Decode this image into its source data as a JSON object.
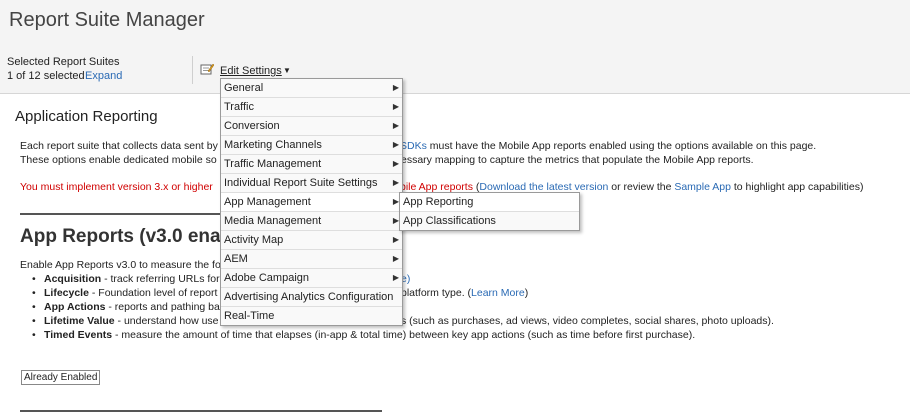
{
  "page_title": "Report Suite Manager",
  "toolbar": {
    "selected_label": "Selected Report Suites",
    "selected_count": "1 of 12 selected",
    "expand_label": "Expand",
    "edit_settings_label": "Edit Settings",
    "edit_icon": "edit-note-icon",
    "caret_icon": "caret-down-icon"
  },
  "section": {
    "heading": "Application Reporting",
    "desc1_prefix": "Each report suite that collects data sent by",
    "desc1_link": "SDKs",
    "desc1_suffix": "must have the Mobile App reports enabled using the options available on this page.",
    "desc2_prefix": "These options enable dedicated mobile so",
    "desc2_suffix": "essary mapping to capture the metrics that populate the Mobile App reports.",
    "warning_prefix": "You must implement version 3.x or higher",
    "warning_mid": "bile App reports",
    "warning_paren_open": " (",
    "warning_link1": "Download the latest version",
    "warning_or": " or review the ",
    "warning_link2": "Sample App",
    "warning_suffix": " to highlight app capabilities)"
  },
  "app_reports": {
    "title": "App Reports (v3.0 enab",
    "intro": "Enable App Reports v3.0 to measure the fo",
    "bullets": [
      {
        "term": "Acquisition",
        "text": " - track referring URLs for",
        "tail_link": "e)"
      },
      {
        "term": "Lifecycle",
        "text": " - Foundation level of report",
        "tail": "platform type. (",
        "tail_link": "Learn More",
        "tail_end": ")"
      },
      {
        "term": "App Actions",
        "text": " - reports and pathing ba"
      },
      {
        "term": "Lifetime Value",
        "text": " - understand how use",
        "tail": "s (such as purchases, ad views, video completes, social shares, photo uploads)."
      },
      {
        "term": "Timed Events",
        "text": " - measure the amount of time that elapses (in-app & total time) between key app actions (such as time before first purchase)."
      }
    ],
    "enabled_button": "Already Enabled"
  },
  "menu": {
    "items": [
      {
        "label": "General",
        "has_submenu": true
      },
      {
        "label": "Traffic",
        "has_submenu": true
      },
      {
        "label": "Conversion",
        "has_submenu": true
      },
      {
        "label": "Marketing Channels",
        "has_submenu": true
      },
      {
        "label": "Traffic Management",
        "has_submenu": true
      },
      {
        "label": "Individual Report Suite Settings",
        "has_submenu": true
      },
      {
        "label": "App Management",
        "has_submenu": true
      },
      {
        "label": "Media Management",
        "has_submenu": true
      },
      {
        "label": "Activity Map",
        "has_submenu": true
      },
      {
        "label": "AEM",
        "has_submenu": true
      },
      {
        "label": "Adobe Campaign",
        "has_submenu": true
      },
      {
        "label": "Advertising Analytics Configuration",
        "has_submenu": false
      },
      {
        "label": "Real-Time",
        "has_submenu": false
      }
    ],
    "active": "App Management",
    "arrow_icon": "triangle-right-icon"
  },
  "submenu": {
    "items": [
      {
        "label": "App Reporting"
      },
      {
        "label": "App Classifications"
      }
    ]
  }
}
